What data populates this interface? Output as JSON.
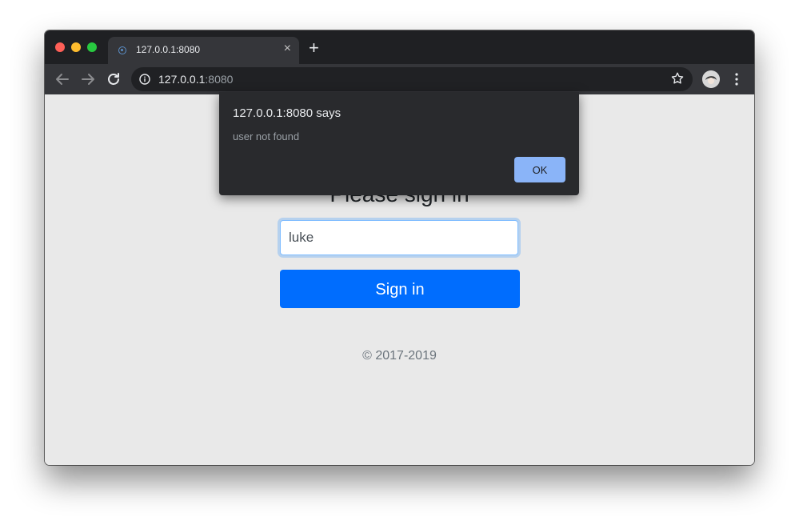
{
  "browser": {
    "tab": {
      "title": "127.0.0.1:8080",
      "close_glyph": "×"
    },
    "new_tab_glyph": "+",
    "url": {
      "host": "127.0.0.1",
      "port": ":8080"
    },
    "icons": [
      "back-arrow-icon",
      "forward-arrow-icon",
      "reload-icon",
      "info-icon",
      "star-icon",
      "avatar",
      "kebab-menu-icon"
    ]
  },
  "page": {
    "heading": "Please sign in",
    "username_value": "luke",
    "signin_label": "Sign in",
    "copyright": "© 2017-2019"
  },
  "dialog": {
    "title": "127.0.0.1:8080 says",
    "message": "user not found",
    "ok_label": "OK"
  },
  "colors": {
    "primary_button": "#006dfe",
    "dialog_bg": "#292a2d",
    "dialog_ok": "#8ab4f8",
    "page_bg": "#e9e9e9"
  }
}
